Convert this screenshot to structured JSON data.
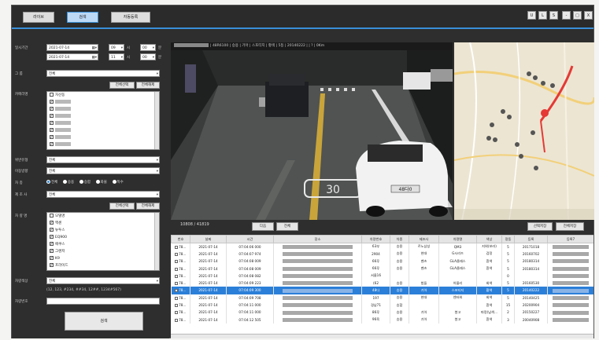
{
  "top": {
    "tabs": [
      {
        "label": "라이브"
      },
      {
        "label": "검색"
      },
      {
        "label": "자동등록"
      }
    ],
    "window_controls": [
      "U",
      "L",
      "S",
      "-",
      "□",
      "X"
    ]
  },
  "search": {
    "period_label": "일시기간",
    "date_from": "2021-07-14",
    "date_to": "2021-07-14",
    "hour_from": "09",
    "min_from": "00",
    "hour_to": "11",
    "min_to": "00",
    "hour_unit": "시",
    "min_unit": "분",
    "group_label": "그  룹",
    "group_value": "전체",
    "select_all": "전체선택",
    "deselect_all": "전체해제",
    "camera_label": "카메라명",
    "camera_first": "자산동",
    "violation_label": "위반유형",
    "violation_value": "전체",
    "direction_label": "이동방향",
    "direction_value": "전체",
    "vehicle_type_label": "차  종",
    "vehicle_types": [
      "전체",
      "승용",
      "승합",
      "화물",
      "특수"
    ],
    "maker_label": "제 조 사",
    "maker_value": "전체",
    "model_label": "차 량 명",
    "models": [
      "모델명",
      "엑센",
      "뉴투스",
      "EQ900",
      "에쿠스",
      "그랜저",
      "K9",
      "프라이드"
    ],
    "color_label": "차량색상",
    "color_value": "전체",
    "plate_hint": "(12, 123, #234, ##34, 12##, 1234#567)",
    "plate_label": "차량번호",
    "search_button": "검색"
  },
  "video": {
    "info": "| 48R6100 | 승용 | 기아 | 스포티지 | 황색 | 5등 | 20140222 | | ? | 0Km",
    "speed_marking": "30",
    "plate_text": "48다0"
  },
  "results": {
    "counter": "10808 / 41819",
    "next_button": "다음",
    "all_button": "전체",
    "save_selected": "선택저장",
    "save_all": "전체저장",
    "columns": [
      "번호",
      "날짜",
      "시간",
      "장소",
      "차량번호",
      "차종",
      "제조사",
      "차량명",
      "색상",
      "정동",
      "등록",
      "등록7"
    ],
    "rows": [
      {
        "no": "78...",
        "date": "2021-07-14",
        "time": "07:04:06 000",
        "plate": "63부",
        "type": "승용",
        "maker": "르노삼성",
        "model": "QM3",
        "color": "지위(보라)",
        "seat": "5",
        "reg": "20171018",
        "sel": false
      },
      {
        "no": "78...",
        "date": "2021-07-14",
        "time": "07:04:07 974",
        "plate": "2904",
        "type": "승용",
        "maker": "현대",
        "model": "G시리즈",
        "color": "검정",
        "seat": "5",
        "reg": "20160702",
        "sel": false
      },
      {
        "no": "78...",
        "date": "2021-07-14",
        "time": "07:04:08 009",
        "plate": "66루",
        "type": "승용",
        "maker": "벤츠",
        "model": "GLA클래스",
        "color": "흰색",
        "seat": "5",
        "reg": "20180314",
        "sel": false
      },
      {
        "no": "78...",
        "date": "2021-07-14",
        "time": "07:04:08 009",
        "plate": "66루",
        "type": "승용",
        "maker": "벤츠",
        "model": "GLA클래스",
        "color": "흰색",
        "seat": "5",
        "reg": "20180314",
        "sel": false
      },
      {
        "no": "78...",
        "date": "2021-07-14",
        "time": "07:04:08 082",
        "plate": "서울16",
        "type": "",
        "maker": "",
        "model": "",
        "color": "",
        "seat": "0",
        "reg": "",
        "sel": false
      },
      {
        "no": "78...",
        "date": "2021-07-14",
        "time": "07:04:09 223",
        "plate": "(62",
        "type": "승용",
        "maker": "험들",
        "model": "아울리",
        "color": "회색",
        "seat": "5",
        "reg": "20160530",
        "sel": false
      },
      {
        "no": "78...",
        "date": "2021-07-14",
        "time": "07:04:09 300",
        "plate": "48다",
        "type": "승용",
        "maker": "기아",
        "model": "스포티지",
        "color": "황색",
        "seat": "5",
        "reg": "20140222",
        "sel": true
      },
      {
        "no": "78...",
        "date": "2021-07-14",
        "time": "07:04:09 708",
        "plate": "197",
        "type": "승용",
        "maker": "현대",
        "model": "엔터워",
        "color": "회색",
        "seat": "5",
        "reg": "20140425",
        "sel": false
      },
      {
        "no": "78...",
        "date": "2021-07-14",
        "time": "07:04:11 000",
        "plate": "경남71",
        "type": "승합",
        "maker": "",
        "model": "",
        "color": "흰색",
        "seat": "15",
        "reg": "20200904",
        "sel": false
      },
      {
        "no": "78...",
        "date": "2021-07-14",
        "time": "07:04:11 000",
        "plate": "86루",
        "type": "승용",
        "maker": "기아",
        "model": "봉고",
        "color": "파랑(남색...",
        "seat": "2",
        "reg": "20150227",
        "sel": false
      },
      {
        "no": "78...",
        "date": "2021-07-14",
        "time": "07:04:12 505",
        "plate": "96육",
        "type": "승용",
        "maker": "기아",
        "model": "봉고",
        "color": "흰색",
        "seat": "3",
        "reg": "20040908",
        "sel": false
      }
    ]
  },
  "colors": {
    "accent": "#3a8fd8",
    "selected_row": "#2b7fd8",
    "panel": "#2d2e2d"
  }
}
